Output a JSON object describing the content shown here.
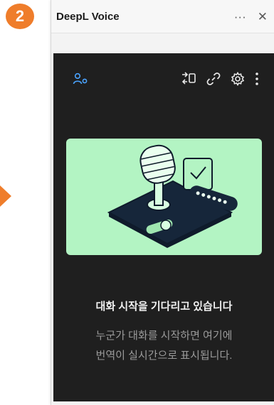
{
  "step_badge": "2",
  "window": {
    "title": "DeepL Voice",
    "more_label": "···",
    "close_label": "✕"
  },
  "toolbar_icons": [
    "profile-icon",
    "swap-icon",
    "link-icon",
    "gear-icon",
    "more-vertical-icon"
  ],
  "colors": {
    "accent": "#ef7d2b",
    "panel_bg": "#1f1f1f",
    "illustration_bg": "#b3f4c3",
    "profile_icon": "#4aa3ff"
  },
  "empty_state": {
    "headline": "대화 시작을 기다리고 있습니다",
    "line1": "누군가 대화를 시작하면 여기에",
    "line2": "번역이 실시간으로 표시됩니다."
  }
}
